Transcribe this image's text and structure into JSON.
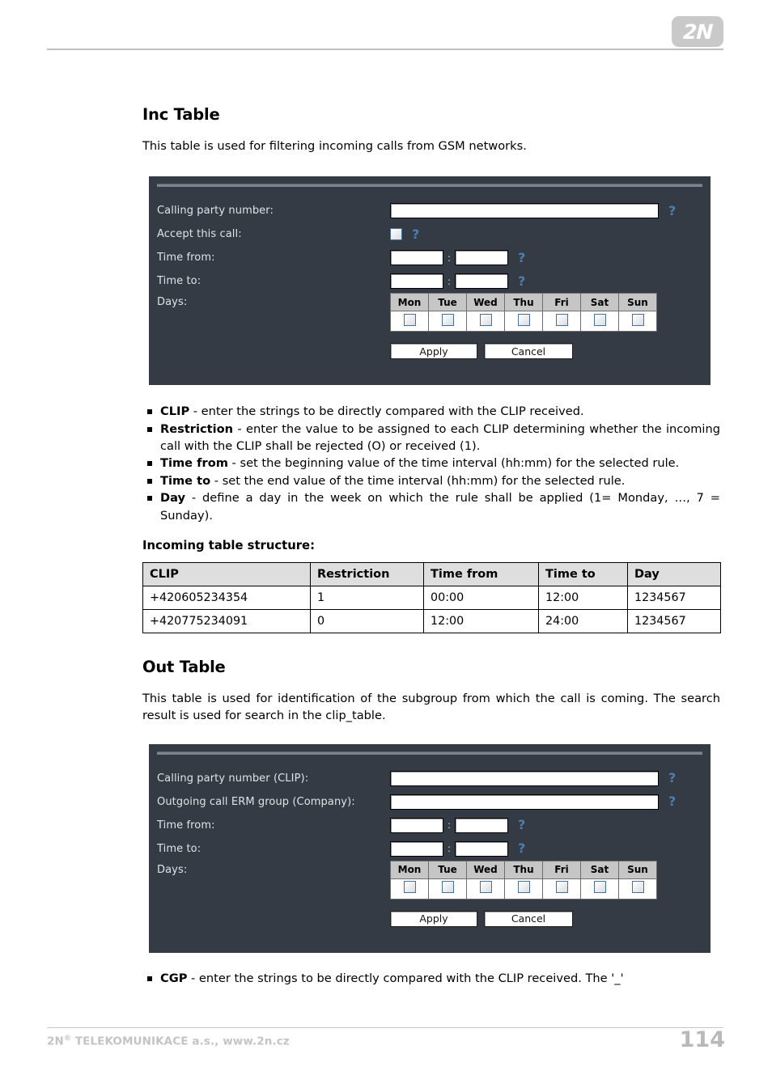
{
  "header": {
    "logo_text": "2N",
    "logo_name": "2n-logo"
  },
  "inc_section": {
    "title": "Inc Table",
    "intro": "This table is used for filtering incoming calls from GSM networks.",
    "form": {
      "labels": {
        "calling_party": "Calling party number:",
        "accept_call": "Accept this call:",
        "time_from": "Time from:",
        "time_to": "Time to:",
        "days": "Days:"
      },
      "values": {
        "calling_party": "",
        "time_from_hh": "",
        "time_from_mm": "",
        "time_to_hh": "",
        "time_to_mm": ""
      },
      "time_separator": ":",
      "help_glyph": "?",
      "days": [
        "Mon",
        "Tue",
        "Wed",
        "Thu",
        "Fri",
        "Sat",
        "Sun"
      ],
      "apply_label": "Apply",
      "cancel_label": "Cancel"
    },
    "bullets": [
      {
        "term": "CLIP",
        "text": " - enter the strings to be directly compared with the CLIP received."
      },
      {
        "term": "Restriction",
        "text": " - enter the value to be assigned to each CLIP determining whether the incoming call with the CLIP shall be rejected (O) or received (1)."
      },
      {
        "term": "Time from",
        "text": " - set the beginning value of the time interval (hh:mm) for the selected rule."
      },
      {
        "term": "Time to",
        "text": " - set the end value of the time interval (hh:mm) for the selected rule."
      },
      {
        "term": "Day",
        "text": " - define a day in the week on which the rule shall be applied (1= Monday, …, 7 = Sunday)."
      }
    ],
    "table_caption": "Incoming table structure:",
    "table": {
      "headers": [
        "CLIP",
        "Restriction",
        "Time from",
        "Time to",
        "Day"
      ],
      "rows": [
        [
          "+420605234354",
          "1",
          "00:00",
          "12:00",
          "1234567"
        ],
        [
          "+420775234091",
          "0",
          "12:00",
          "24:00",
          "1234567"
        ]
      ]
    }
  },
  "out_section": {
    "title": "Out Table",
    "intro": "This table is used for identification of the subgroup from which the call is coming. The search result is used for search in the clip_table.",
    "form": {
      "labels": {
        "calling_party": "Calling party number (CLIP):",
        "erm_group": "Outgoing call ERM group (Company):",
        "time_from": "Time from:",
        "time_to": "Time to:",
        "days": "Days:"
      },
      "values": {
        "calling_party": "",
        "erm_group": "",
        "time_from_hh": "",
        "time_from_mm": "",
        "time_to_hh": "",
        "time_to_mm": ""
      },
      "time_separator": ":",
      "help_glyph": "?",
      "days": [
        "Mon",
        "Tue",
        "Wed",
        "Thu",
        "Fri",
        "Sat",
        "Sun"
      ],
      "apply_label": "Apply",
      "cancel_label": "Cancel"
    },
    "bullets": [
      {
        "term": "CGP",
        "text": " - enter the strings to be directly compared with the CLIP received. The '_'"
      }
    ]
  },
  "footer": {
    "company_prefix": "2N",
    "registered": "®",
    "company_suffix": " TELEKOMUNIKACE a.s., www.2n.cz",
    "page_number": "114"
  }
}
